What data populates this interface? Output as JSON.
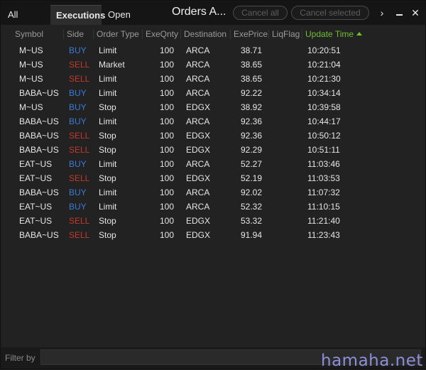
{
  "tabs": [
    {
      "label": "All Orders",
      "active": false
    },
    {
      "label": "Executions",
      "active": true
    },
    {
      "label": "Open Orders",
      "active": false
    }
  ],
  "window_title": "Orders A...",
  "buttons": {
    "cancel_all": "Cancel all",
    "cancel_selected": "Cancel selected"
  },
  "controls": {
    "more": "›",
    "close": "✕"
  },
  "columns": {
    "symbol": "Symbol",
    "side": "Side",
    "order_type": "Order Type",
    "exe_qnty": "ExeQnty",
    "destination": "Destination",
    "exe_price": "ExePrice",
    "liq_flag": "LiqFlag",
    "update_time": "Update Time"
  },
  "sort": {
    "column": "update_time",
    "direction": "ascending"
  },
  "colors": {
    "buy": "#3a7bd5",
    "sell": "#c0392b",
    "sorted_header": "#6fbf2f"
  },
  "rows": [
    {
      "symbol": "M~US",
      "side": "BUY",
      "type": "Limit",
      "qty": "100",
      "dest": "ARCA",
      "price": "38.71",
      "liq": "",
      "time": "10:20:51"
    },
    {
      "symbol": "M~US",
      "side": "SELL",
      "type": "Market",
      "qty": "100",
      "dest": "ARCA",
      "price": "38.65",
      "liq": "",
      "time": "10:21:04"
    },
    {
      "symbol": "M~US",
      "side": "SELL",
      "type": "Limit",
      "qty": "100",
      "dest": "ARCA",
      "price": "38.65",
      "liq": "",
      "time": "10:21:30"
    },
    {
      "symbol": "BABA~US",
      "side": "BUY",
      "type": "Limit",
      "qty": "100",
      "dest": "ARCA",
      "price": "92.22",
      "liq": "",
      "time": "10:34:14"
    },
    {
      "symbol": "M~US",
      "side": "BUY",
      "type": "Stop",
      "qty": "100",
      "dest": "EDGX",
      "price": "38.92",
      "liq": "",
      "time": "10:39:58"
    },
    {
      "symbol": "BABA~US",
      "side": "BUY",
      "type": "Limit",
      "qty": "100",
      "dest": "ARCA",
      "price": "92.36",
      "liq": "",
      "time": "10:44:17"
    },
    {
      "symbol": "BABA~US",
      "side": "SELL",
      "type": "Stop",
      "qty": "100",
      "dest": "EDGX",
      "price": "92.36",
      "liq": "",
      "time": "10:50:12"
    },
    {
      "symbol": "BABA~US",
      "side": "SELL",
      "type": "Stop",
      "qty": "100",
      "dest": "EDGX",
      "price": "92.29",
      "liq": "",
      "time": "10:51:11"
    },
    {
      "symbol": "EAT~US",
      "side": "BUY",
      "type": "Limit",
      "qty": "100",
      "dest": "ARCA",
      "price": "52.27",
      "liq": "",
      "time": "11:03:46"
    },
    {
      "symbol": "EAT~US",
      "side": "SELL",
      "type": "Stop",
      "qty": "100",
      "dest": "EDGX",
      "price": "52.19",
      "liq": "",
      "time": "11:03:53"
    },
    {
      "symbol": "BABA~US",
      "side": "BUY",
      "type": "Limit",
      "qty": "100",
      "dest": "ARCA",
      "price": "92.02",
      "liq": "",
      "time": "11:07:32"
    },
    {
      "symbol": "EAT~US",
      "side": "BUY",
      "type": "Limit",
      "qty": "100",
      "dest": "ARCA",
      "price": "52.32",
      "liq": "",
      "time": "11:10:15"
    },
    {
      "symbol": "EAT~US",
      "side": "SELL",
      "type": "Stop",
      "qty": "100",
      "dest": "EDGX",
      "price": "53.32",
      "liq": "",
      "time": "11:21:40"
    },
    {
      "symbol": "BABA~US",
      "side": "SELL",
      "type": "Stop",
      "qty": "100",
      "dest": "EDGX",
      "price": "91.94",
      "liq": "",
      "time": "11:23:43"
    }
  ],
  "filter": {
    "label": "Filter by",
    "value": "",
    "placeholder": ""
  },
  "watermark": "hamaha.net"
}
